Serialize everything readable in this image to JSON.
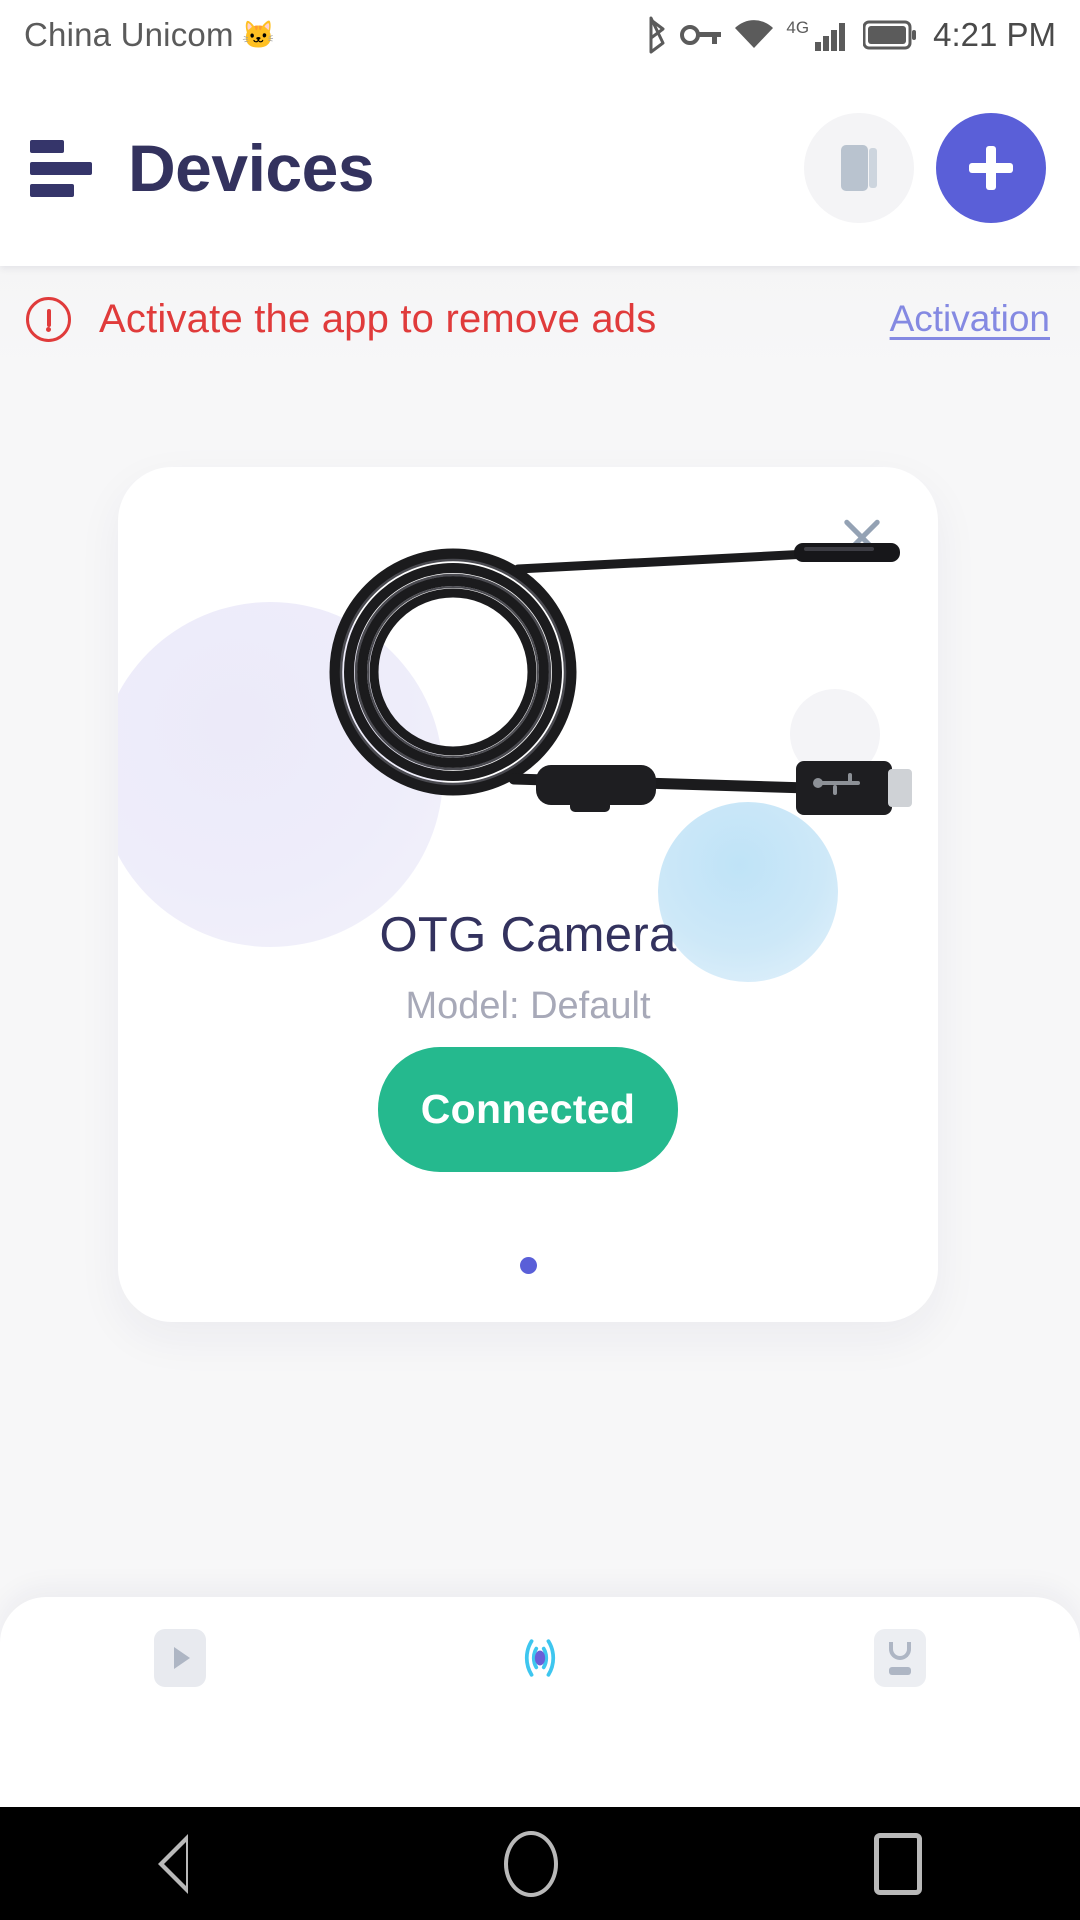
{
  "status_bar": {
    "carrier": "China Unicom",
    "carrier_glyph": "cat-icon",
    "icons": [
      "bluetooth-icon",
      "vpn-key-icon",
      "wifi-icon",
      "cellular-signal-icon",
      "battery-icon"
    ],
    "network_type": "4G",
    "time": "4:21 PM"
  },
  "app_bar": {
    "menu_icon": "hamburger-menu-icon",
    "title": "Devices",
    "secondary_icon": "book-icon",
    "primary_icon": "plus-icon"
  },
  "banner": {
    "icon": "alert-circle-icon",
    "message": "Activate the app to remove ads",
    "link_label": "Activation",
    "text_color": "#e03b3b",
    "link_color": "#8489e2"
  },
  "device_card": {
    "close_icon": "close-icon",
    "illustration": "otg-camera-cable-illustration",
    "name": "OTG Camera",
    "model": "Model: Default",
    "status_label": "Connected",
    "status_color": "#25b98e",
    "page_dots": 1,
    "active_dot": 0,
    "active_dot_color": "#5a5fd8"
  },
  "tab_bar": {
    "tabs": [
      {
        "name": "media-tab",
        "icon": "play-chip-icon",
        "active": false
      },
      {
        "name": "connect-tab",
        "icon": "broadcast-signal-icon",
        "active": true
      },
      {
        "name": "usb-device-tab",
        "icon": "usb-device-icon",
        "active": false
      }
    ],
    "indicator_color": "#5a5fd8"
  },
  "android_nav": {
    "buttons": [
      "back-button",
      "home-button",
      "recents-button"
    ]
  }
}
